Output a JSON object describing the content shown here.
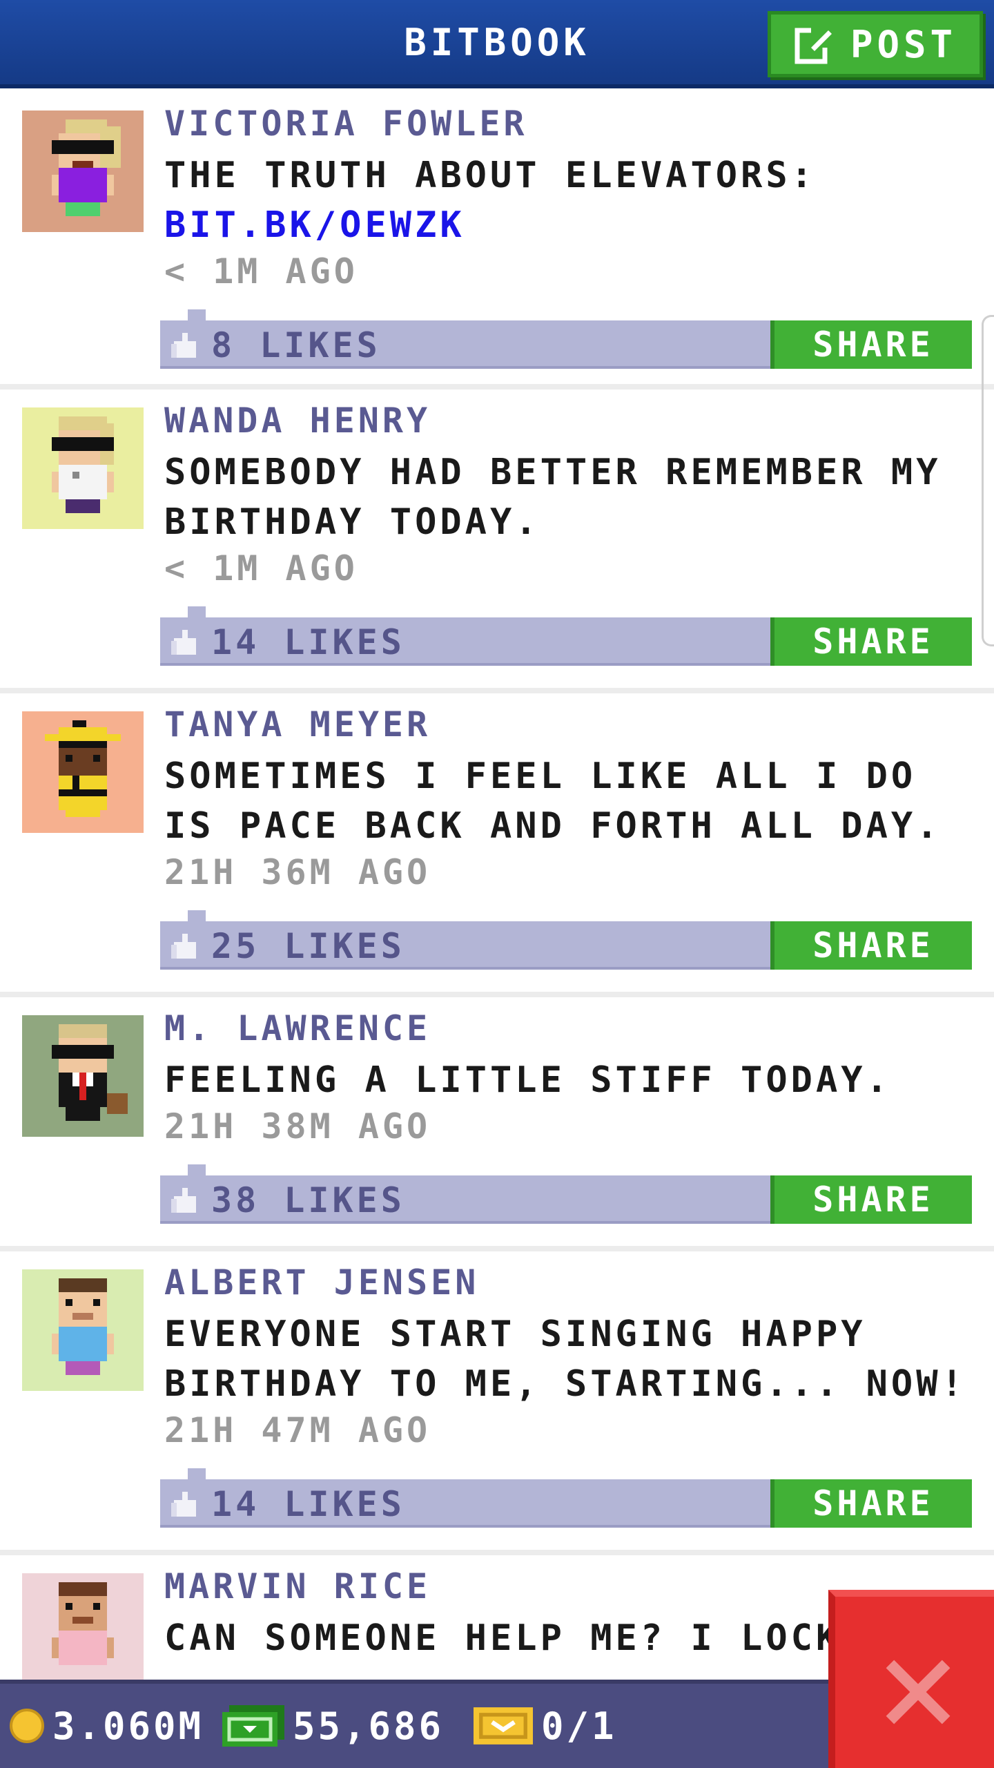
{
  "header": {
    "title": "BITBOOK",
    "post_label": "POST"
  },
  "posts": [
    {
      "name": "VICTORIA FOWLER",
      "text": "THE TRUTH ABOUT ELEVATORS:",
      "link": "BIT.BK/OEWZK",
      "time": "< 1M AGO",
      "likes": "8 LIKES",
      "share": "SHARE",
      "bg": "#d9a083"
    },
    {
      "name": "WANDA HENRY",
      "text": "SOMEBODY HAD BETTER REMEMBER MY BIRTHDAY TODAY.",
      "time": "< 1M AGO",
      "likes": "14 LIKES",
      "share": "SHARE",
      "bg": "#eaeea0"
    },
    {
      "name": "TANYA MEYER",
      "text": "SOMETIMES I FEEL LIKE ALL I DO IS PACE BACK AND FORTH ALL DAY.",
      "time": "21H 36M AGO",
      "likes": "25 LIKES",
      "share": "SHARE",
      "bg": "#f6b08f"
    },
    {
      "name": "M. LAWRENCE",
      "text": "FEELING A LITTLE STIFF TODAY.",
      "time": "21H 38M AGO",
      "likes": "38 LIKES",
      "share": "SHARE",
      "bg": "#90a77f"
    },
    {
      "name": "ALBERT JENSEN",
      "text": "EVERYONE START SINGING HAPPY BIRTHDAY TO ME, STARTING... NOW!",
      "time": "21H 47M AGO",
      "likes": "14 LIKES",
      "share": "SHARE",
      "bg": "#d9ecb1"
    },
    {
      "name": "MARVIN RICE",
      "text": "CAN SOMEONE HELP ME? I LOCK",
      "bg": "#efd3d8"
    }
  ],
  "footer": {
    "coins": "3.060M",
    "bux": "55,686",
    "tickets": "0/1"
  },
  "colors": {
    "header": "#1f4ca6",
    "green": "#41b136",
    "like_bar": "#b3b5d6",
    "name": "#5a5a92",
    "footer": "#4b4c80",
    "close": "#e62f2f"
  },
  "icons": {
    "post": "edit-icon",
    "like": "thumb-icon",
    "coins": "coin-icon",
    "bux": "bux-icon",
    "tickets": "ticket-icon",
    "close": "close-icon"
  }
}
